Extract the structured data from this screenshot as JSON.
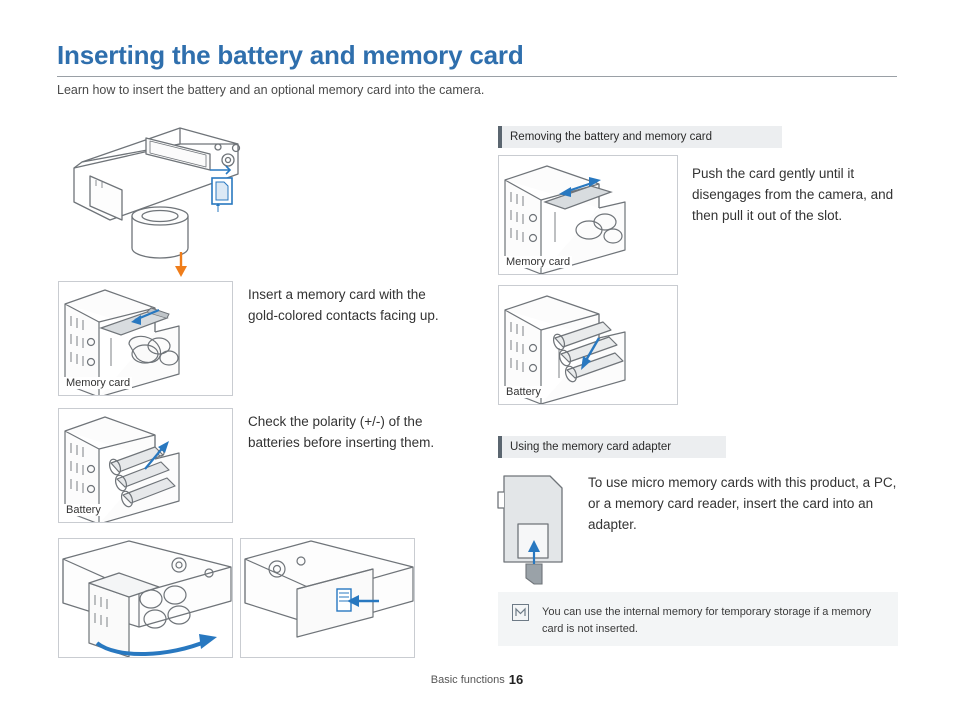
{
  "page": {
    "title": "Inserting the battery and memory card",
    "subtitle": "Learn how to insert the battery and an optional memory card into the camera.",
    "footer_label": "Basic functions",
    "page_number": "16",
    "accent_color": "#2f6fad",
    "arrow_color": "#2878c0",
    "orange_arrow_color": "#ef7d1a"
  },
  "left_column": {
    "figures": {
      "camera_top": {
        "label": ""
      },
      "memory_card_insert": {
        "label": "Memory card"
      },
      "battery_insert": {
        "label": "Battery"
      },
      "cover_open": {
        "label": ""
      },
      "cover_close": {
        "label": ""
      }
    },
    "paragraphs": [
      "Insert a memory card with the gold-colored contacts facing up.",
      "Check the polarity (+/-) of the batteries before inserting them."
    ]
  },
  "right_column": {
    "sections": [
      {
        "heading": "Removing the battery and memory card",
        "paragraph": "Push the card gently until it disengages from the camera, and then pull it out of the slot.",
        "figures": [
          {
            "label": "Memory card"
          },
          {
            "label": "Battery"
          }
        ]
      },
      {
        "heading": "Using the memory card adapter",
        "paragraph": "To use micro memory cards with this product, a PC, or a memory card reader, insert the card into an adapter.",
        "figures": []
      }
    ],
    "note": {
      "icon": "note-pencil-icon",
      "text": "You can use the internal memory for temporary storage if a memory card is not inserted."
    }
  }
}
